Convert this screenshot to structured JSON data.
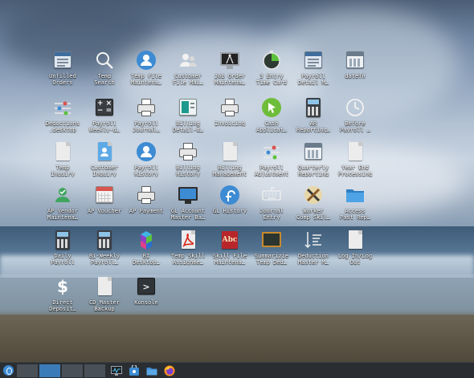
{
  "desktop": {
    "icons": [
      {
        "label": "Unfilled\nOrders",
        "icon": "window-list-icon"
      },
      {
        "label": "Temp\nSearch",
        "icon": "magnifier-icon"
      },
      {
        "label": "Temp File\nMainteпa…",
        "icon": "user-circle-icon"
      },
      {
        "label": "Customer\nFile Mai…",
        "icon": "users-icon"
      },
      {
        "label": "Job Order\nMainteпa…",
        "icon": "drafting-monitor-icon"
      },
      {
        "label": "3 Entry\nTime Card",
        "icon": "stopwatch-icon"
      },
      {
        "label": "Payroll\nDetail M…",
        "icon": "window-list-icon"
      },
      {
        "label": "datefn",
        "icon": "calendar-icon"
      },
      {
        "label": "Deductions\n.desktop",
        "icon": "sliders-icon"
      },
      {
        "label": "Payroll\nWeekly-d…",
        "icon": "calculator-symbols-icon"
      },
      {
        "label": "Payroll\nJournal…",
        "icon": "printer-icon"
      },
      {
        "label": "Billing\nDetail-d…",
        "icon": "teal-app-icon"
      },
      {
        "label": "Invoicing",
        "icon": "printer-icon"
      },
      {
        "label": "Cash\nApplicat…",
        "icon": "green-cursor-icon"
      },
      {
        "label": "AR\nReporting…",
        "icon": "calculator-icon"
      },
      {
        "label": "Before\nPayroll …",
        "icon": "clock-icon"
      },
      {
        "label": "Temp\nInquiry",
        "icon": "document-icon"
      },
      {
        "label": "Customer\nInquiry",
        "icon": "user-document-icon"
      },
      {
        "label": "Payroll\nHistory",
        "icon": "user-circle-icon"
      },
      {
        "label": "Billing\nHistory",
        "icon": "printer-icon"
      },
      {
        "label": "Billing\nManagement",
        "icon": "document-icon"
      },
      {
        "label": "Payroll\nAdjustment",
        "icon": "sliders-icon"
      },
      {
        "label": "Quarterly\nReporting",
        "icon": "calendar-icon"
      },
      {
        "label": "Year End\nProcessing",
        "icon": "document-icon"
      },
      {
        "label": "AP Vendor\nMainteпa…",
        "icon": "vendor-icon"
      },
      {
        "label": "AP Voucher",
        "icon": "calendar-grid-icon"
      },
      {
        "label": "AP Payment",
        "icon": "printer-icon"
      },
      {
        "label": "GL Account\nMaster Ba…",
        "icon": "monitor-icon"
      },
      {
        "label": "GL History",
        "icon": "fedora-icon"
      },
      {
        "label": "Journal\nEntry",
        "icon": "keyboard-icon"
      },
      {
        "label": "Worker\nComp Skil…",
        "icon": "tools-icon"
      },
      {
        "label": "Access\nPast Rep…",
        "icon": "folder-icon"
      },
      {
        "label": "Daily\nPayroll",
        "icon": "calculator-icon"
      },
      {
        "label": "Bi-Weekly\nPayroll…",
        "icon": "calculator-icon"
      },
      {
        "label": "BI\nDesktop…",
        "icon": "bi-cubes-icon"
      },
      {
        "label": "Temp Skill\nAssignme…",
        "icon": "pdf-icon"
      },
      {
        "label": "Skill File\nMaintena…",
        "icon": "book-icon"
      },
      {
        "label": "Summarizie\nTemp Ded…",
        "icon": "chalkboard-icon"
      },
      {
        "label": "Deduction\nMaster M…",
        "icon": "sort-list-icon"
      },
      {
        "label": "Log In/Log\nOut",
        "icon": "document-icon"
      },
      {
        "label": "Direct\nDeposit…",
        "icon": "dollar-icon"
      },
      {
        "label": "CD Master\nBackup",
        "icon": "document-icon"
      },
      {
        "label": "Konsole",
        "icon": "terminal-icon"
      }
    ]
  },
  "taskbar": {
    "launcher": "fedora-launcher-icon",
    "pager": [
      "desktop-1",
      "desktop-2",
      "desktop-3",
      "desktop-4"
    ],
    "active_desktop": 1,
    "apps": [
      {
        "name": "system-monitor-icon"
      },
      {
        "name": "discover-icon"
      },
      {
        "name": "file-manager-icon"
      },
      {
        "name": "firefox-icon"
      }
    ]
  },
  "colors": {
    "taskbar_bg": "#2a2e32",
    "accent_blue": "#3d8bd3"
  }
}
